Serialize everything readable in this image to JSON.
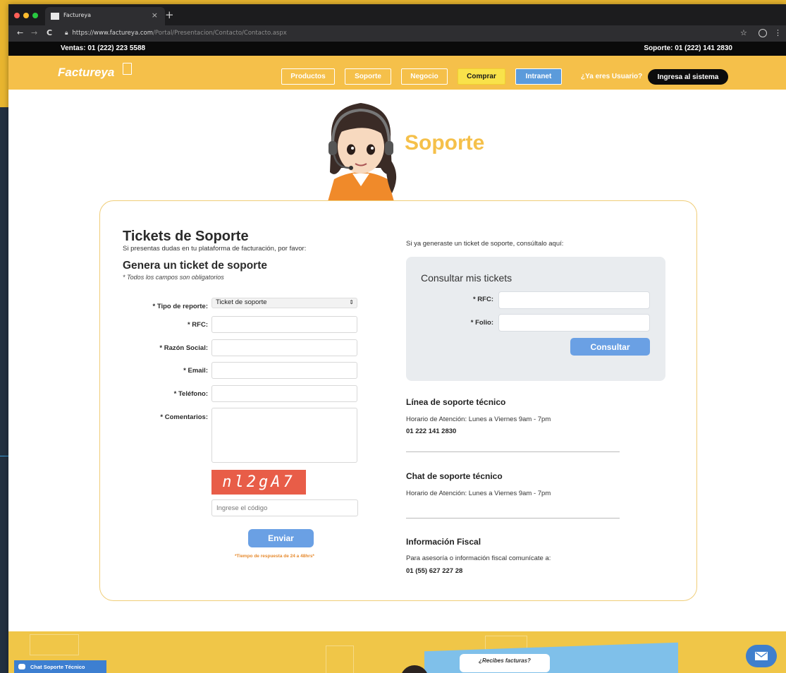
{
  "browser": {
    "tab_title": "Factureya",
    "tab_close": "×",
    "new_tab": "+",
    "back": "←",
    "forward": "→",
    "reload": "C",
    "url_main": "https://www.factureya.com",
    "url_path": "/Portal/Presentacion/Contacto/Contacto.aspx",
    "star": "☆",
    "menu": "⋮"
  },
  "topbar": {
    "ventas": "Ventas: 01 (222) 223 5588",
    "soporte": "Soporte: 01 (222) 141 2830"
  },
  "header": {
    "logo": "Factureya",
    "nav": [
      "Productos",
      "Soporte",
      "Negocio",
      "Comprar",
      "Intranet"
    ],
    "question": "¿Ya eres Usuario?",
    "login": "Ingresa al sistema"
  },
  "hero": {
    "title": "Soporte"
  },
  "form": {
    "title": "Tickets de Soporte",
    "subtitle": "Si presentas dudas en tu plataforma de facturación, por favor:",
    "heading": "Genera un ticket de soporte",
    "note": "* Todos los campos son obligatorios",
    "labels": {
      "tipo": "* Tipo de reporte:",
      "rfc": "* RFC:",
      "razon": "* Razón Social:",
      "email": "* Email:",
      "telefono": "* Teléfono:",
      "comentarios": "* Comentarios:"
    },
    "tipo_value": "Ticket de soporte",
    "captcha": "nl2gA7",
    "code_placeholder": "Ingrese el código",
    "submit": "Enviar",
    "response_time": "*Tiempo de respuesta de 24 a 48hrs*"
  },
  "consult": {
    "intro": "Si ya generaste un ticket de soporte, consúltalo aquí:",
    "title": "Consultar mis tickets",
    "rfc_label": "* RFC:",
    "folio_label": "* Folio:",
    "button": "Consultar"
  },
  "support_line": {
    "title": "Línea de soporte técnico",
    "hours": "Horario de Atención: Lunes a Viernes 9am - 7pm",
    "phone": "01 222 141 2830"
  },
  "support_chat": {
    "title": "Chat de soporte técnico",
    "hours": "Horario de Atención: Lunes a Viernes 9am - 7pm"
  },
  "fiscal": {
    "title": "Información Fiscal",
    "text": "Para asesoría o información fiscal comunícate a:",
    "phone": "01 (55) 627 227 28"
  },
  "footer": {
    "bubble": "¿Recibes facturas?",
    "chat": "Chat Soporte Técnico"
  },
  "colors": {
    "brand_yellow": "#f5c04a",
    "button_blue": "#6aa0e4",
    "captcha_red": "#e85d48"
  }
}
